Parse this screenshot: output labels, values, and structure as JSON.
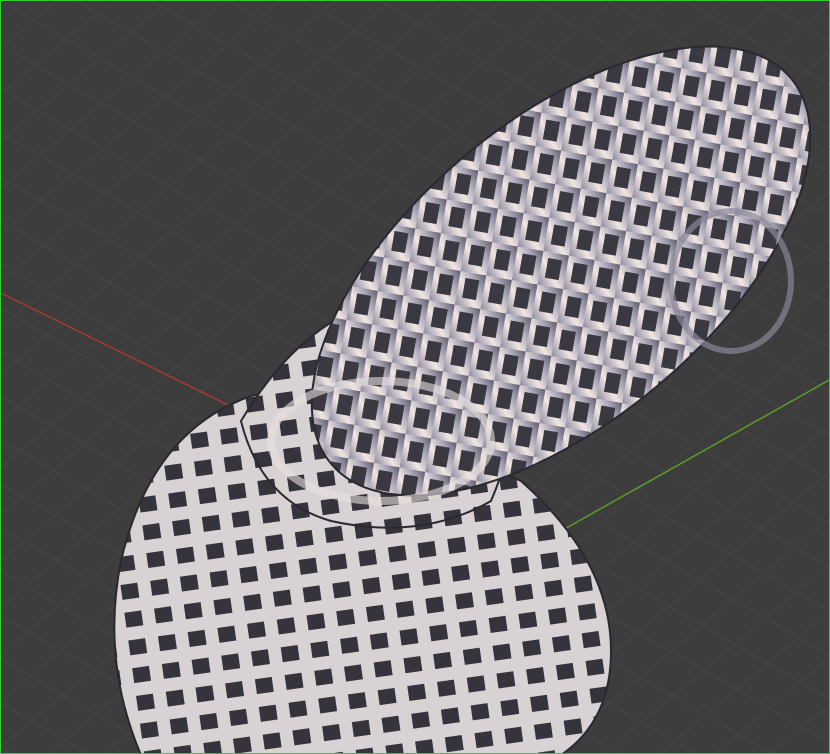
{
  "viewport": {
    "background_color": "#3d3d3d",
    "grid_color": "#4a4a4a",
    "x_axis_color": "#a33a3a",
    "y_axis_color": "#5d9a2a",
    "active_border_color": "#2fd12f",
    "object_base_color": "#c8c4cc",
    "object_shadow_color": "#3a3840"
  }
}
